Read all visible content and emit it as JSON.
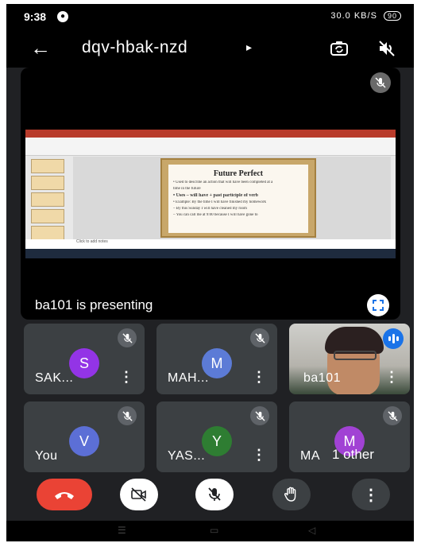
{
  "status_bar": {
    "time": "9:38",
    "notification_badge": "●",
    "signal_info": "30.0 KB/S",
    "battery": "90"
  },
  "app_bar": {
    "back_label": "←",
    "meeting_code": "dqv-hbak-nzd",
    "code_arrow": "▸"
  },
  "presentation": {
    "presenter_text": "ba101 is presenting",
    "slide_title": "Future Perfect",
    "slide_lines": [
      "• Used to describe an action that will have been completed at a",
      "  time in the future",
      "• Uses – will have + past participle of verb",
      "• Example: By the time I will have finished my homework",
      "  – By this Sunday I will have cleaned my room",
      "  – You can call me at 9:00 because I will have gone to"
    ],
    "notes_text": "Click to add notes"
  },
  "participants": [
    {
      "initial": "S",
      "name": "SAK...",
      "color": "#9334e6",
      "more": "⋮"
    },
    {
      "initial": "M",
      "name": "MAH...",
      "color": "#5c7bd6",
      "more": "⋮"
    },
    {
      "initial": "",
      "name": "ba101",
      "color": "",
      "more": "⋮"
    },
    {
      "initial": "V",
      "name": "You",
      "color": "#5c6fd6",
      "more": ""
    },
    {
      "initial": "Y",
      "name": "YAS...",
      "color": "#2e7d32",
      "more": "⋮"
    },
    {
      "initial": "M",
      "name": "MA",
      "color": "#a142d4",
      "more": ""
    }
  ],
  "others_label": "1 other",
  "controls": {
    "end_call_color": "#ea4335",
    "hand_color": "#3c4043"
  },
  "icons": [
    "back-arrow-icon",
    "camera-switch-icon",
    "speaker-off-icon",
    "mic-off-icon",
    "fullscreen-icon",
    "end-call-icon",
    "camera-off-icon",
    "raise-hand-icon",
    "more-options-icon"
  ]
}
